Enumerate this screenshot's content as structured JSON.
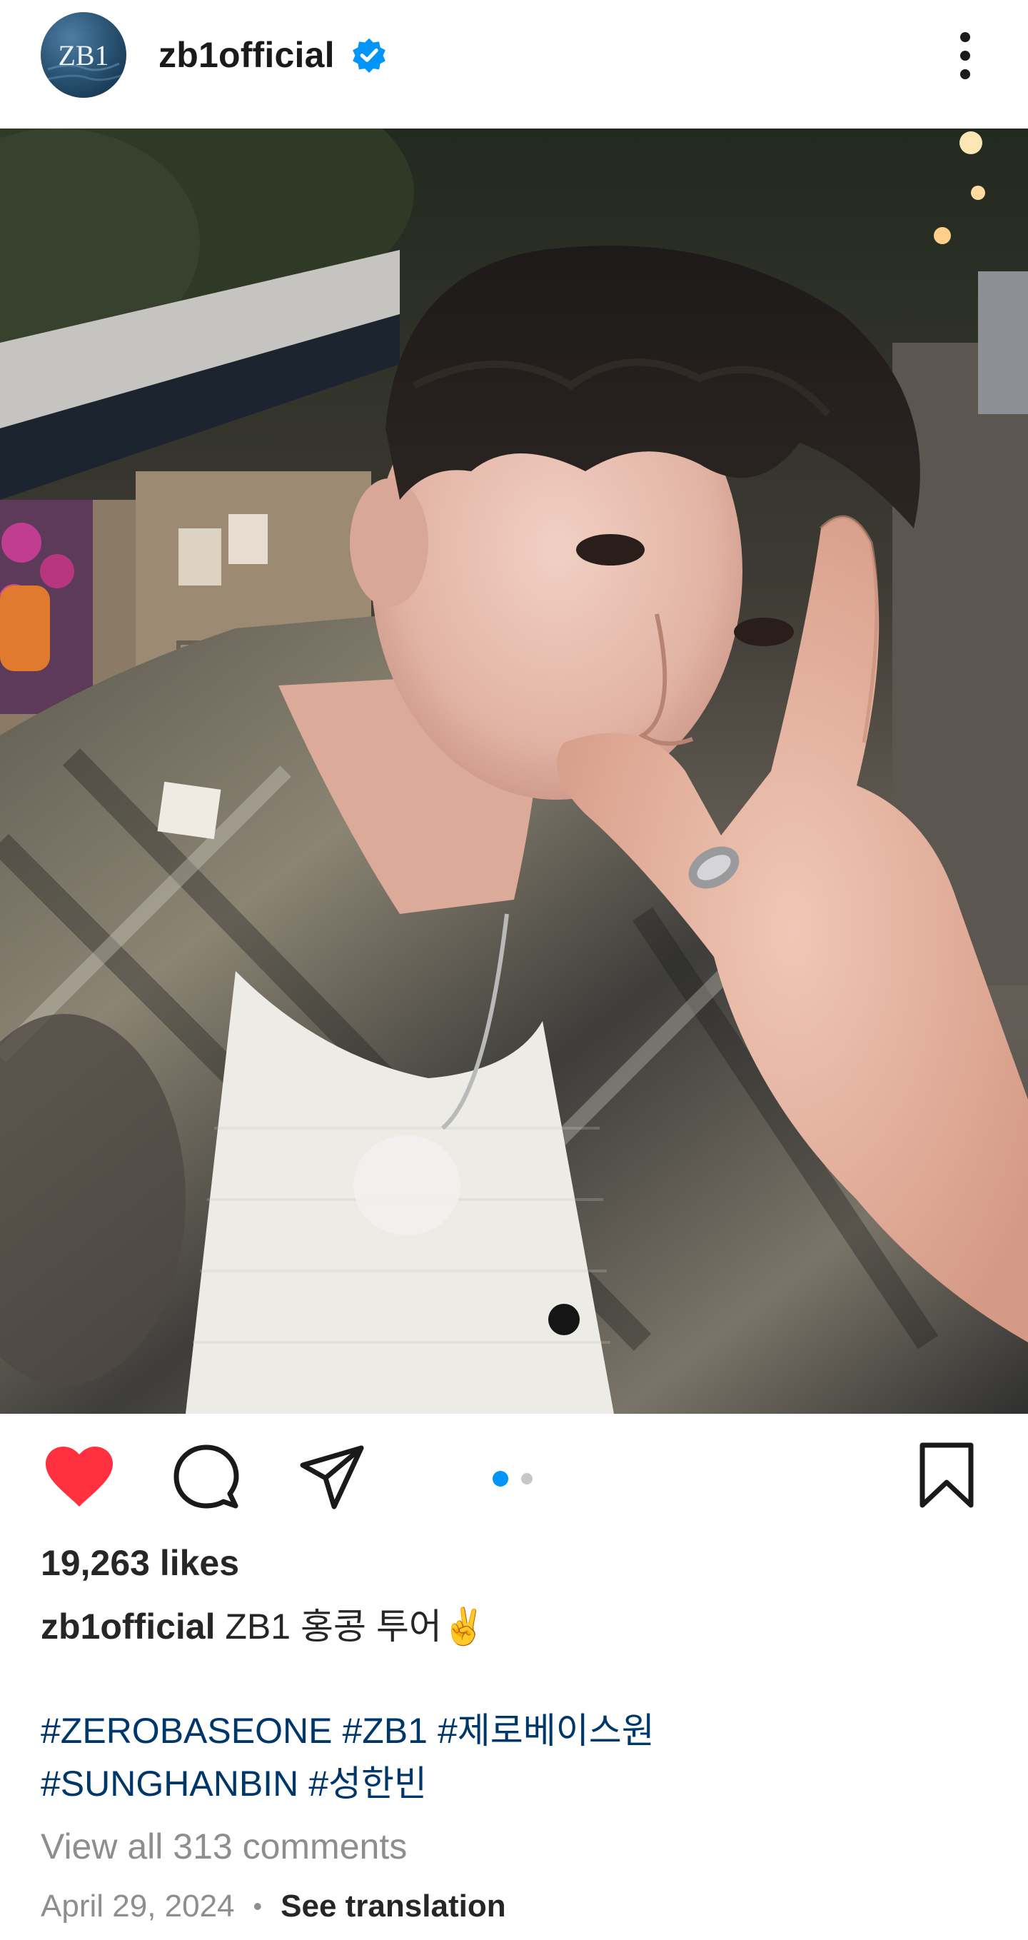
{
  "header": {
    "avatar_text": "ZB1",
    "username": "zb1official",
    "verified": true,
    "verified_icon": "verified-badge-icon",
    "more_icon": "more-vertical-icon"
  },
  "photo": {
    "description_icon": "post-photo"
  },
  "actions": {
    "like_icon": "heart-filled-icon",
    "comment_icon": "comment-icon",
    "share_icon": "send-icon",
    "save_icon": "bookmark-icon",
    "carousel_active_index": 1,
    "carousel_count": 2
  },
  "likes": {
    "text": "19,263 likes"
  },
  "caption": {
    "username": "zb1official",
    "text": "ZB1 홍콩 투어✌️"
  },
  "hashtags": [
    "#ZEROBASEONE",
    "#ZB1",
    "#제로베이스원",
    "#SUNGHANBIN",
    "#성한빈"
  ],
  "comments": {
    "view_all": "View all 313 comments"
  },
  "meta": {
    "date": "April 29, 2024",
    "separator": "•",
    "translation": "See translation"
  },
  "colors": {
    "accent_blue": "#0095f6",
    "heart_red": "#ff3040",
    "hashtag_blue": "#00376b",
    "muted_gray": "#8e8e8e",
    "text_dark": "#262626"
  }
}
